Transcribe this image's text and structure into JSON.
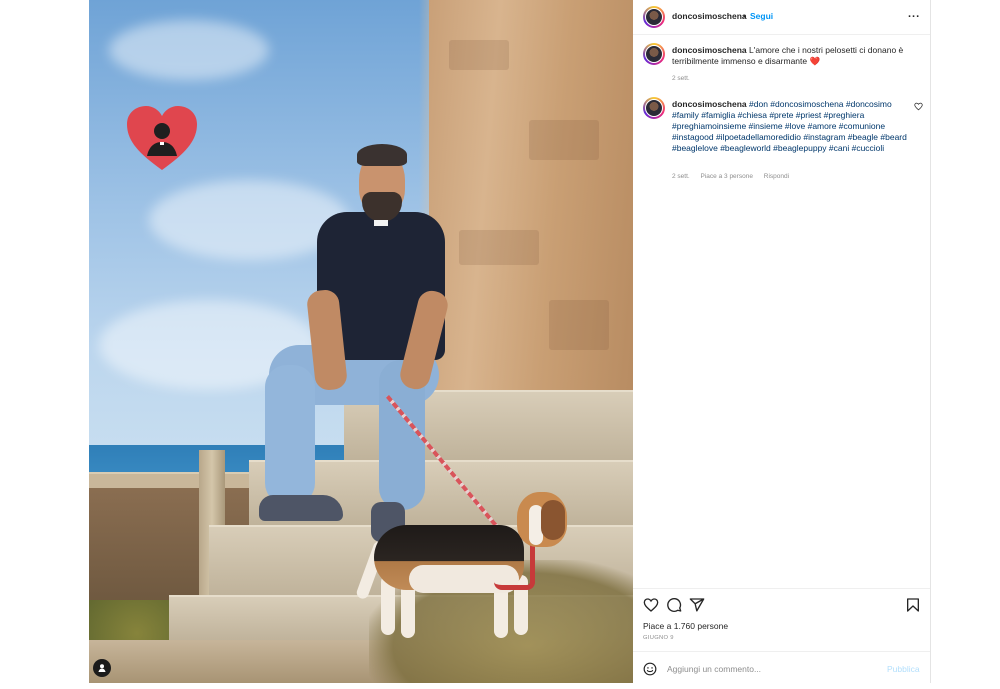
{
  "post": {
    "photo_description_icon": "person-tag-icon"
  },
  "header": {
    "username": "doncosimoschena",
    "separator": "•",
    "follow_label": "Segui",
    "more_label": "..."
  },
  "caption": {
    "username": "doncosimoschena",
    "text": "L'amore che i nostri pelosetti ci donano è terribilmente immenso e disarmante",
    "emoji": "❤️",
    "time": "2 sett."
  },
  "comment": {
    "username": "doncosimoschena",
    "hashtags": "#don #doncosimoschena #doncosimo #family #famiglia #chiesa #prete #priest #preghiera #preghiamoinsieme #insieme #love #amore #comunione #instagood #ilpoetadellamoredidio #instagram #beagle #beard #beaglelove #beagleworld #beaglepuppy #cani #cuccioli",
    "time": "2 sett.",
    "likes": "Piace a 3 persone",
    "reply": "Rispondi"
  },
  "actions": {
    "like_icon": "heart-icon",
    "comment_icon": "comment-icon",
    "share_icon": "share-icon",
    "save_icon": "bookmark-icon",
    "likes_text": "Piace a 1.760 persone",
    "date": "GIUGNO 9"
  },
  "add_comment": {
    "emoji_icon": "emoji-icon",
    "placeholder": "Aggiungi un commento...",
    "publish_label": "Pubblica"
  },
  "colors": {
    "link_blue": "#0095f6",
    "hashtag_blue": "#00376b",
    "muted": "#8e8e8e",
    "publish_disabled": "#b2dffc",
    "heart_red": "#e0464e"
  }
}
